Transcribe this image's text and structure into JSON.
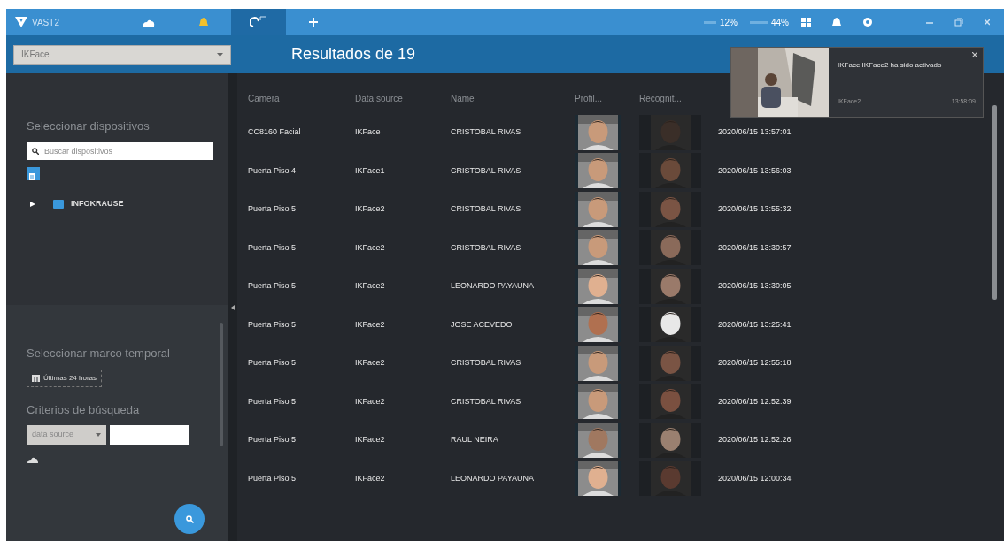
{
  "app": {
    "name": "VAST2"
  },
  "tabs": [
    {
      "kind": "cloud",
      "selected": false
    },
    {
      "kind": "alert",
      "selected": false
    },
    {
      "kind": "face",
      "selected": true
    },
    {
      "kind": "add",
      "selected": false
    }
  ],
  "stats": [
    {
      "kind": "cpu",
      "reading": "12%"
    },
    {
      "kind": "memory",
      "reading": "44%"
    }
  ],
  "toolbar": {
    "source_select": "IKFace",
    "results_title": "Resultados de 19"
  },
  "sidebar": {
    "devices_title": "Seleccionar dispositivos",
    "search": {
      "placeholder": "Buscar dispositivos"
    },
    "tree": [
      {
        "label": "INFOKRAUSE",
        "expanded": false
      }
    ],
    "time_title": "Seleccionar marco temporal",
    "time_button": "Últimas 24 horas",
    "criteria_title": "Criterios de búsqueda",
    "criteria_select": "data source"
  },
  "table": {
    "columns": [
      "Camera",
      "Data source",
      "Name",
      "Profil...",
      "Recognit..."
    ],
    "rows": [
      {
        "camera": "CC8160 Facial",
        "source": "IKFace",
        "name": "CRISTOBAL RIVAS",
        "time": "2020/06/15 13:57:01"
      },
      {
        "camera": "Puerta Piso 4",
        "source": "IKFace1",
        "name": "CRISTOBAL RIVAS",
        "time": "2020/06/15 13:56:03"
      },
      {
        "camera": "Puerta Piso 5",
        "source": "IKFace2",
        "name": "CRISTOBAL RIVAS",
        "time": "2020/06/15 13:55:32"
      },
      {
        "camera": "Puerta Piso 5",
        "source": "IKFace2",
        "name": "CRISTOBAL RIVAS",
        "time": "2020/06/15 13:30:57"
      },
      {
        "camera": "Puerta Piso 5",
        "source": "IKFace2",
        "name": "LEONARDO PAYAUNA",
        "time": "2020/06/15 13:30:05"
      },
      {
        "camera": "Puerta Piso 5",
        "source": "IKFace2",
        "name": "JOSE ACEVEDO",
        "time": "2020/06/15 13:25:41"
      },
      {
        "camera": "Puerta Piso 5",
        "source": "IKFace2",
        "name": "CRISTOBAL RIVAS",
        "time": "2020/06/15 12:55:18"
      },
      {
        "camera": "Puerta Piso 5",
        "source": "IKFace2",
        "name": "CRISTOBAL RIVAS",
        "time": "2020/06/15 12:52:39"
      },
      {
        "camera": "Puerta Piso 5",
        "source": "IKFace2",
        "name": "RAUL NEIRA",
        "time": "2020/06/15 12:52:26"
      },
      {
        "camera": "Puerta Piso 5",
        "source": "IKFace2",
        "name": "LEONARDO PAYAUNA",
        "time": "2020/06/15 12:00:34"
      }
    ]
  },
  "notification": {
    "message": "IKFace IKFace2 ha sido activado",
    "source": "IKFace2",
    "time": "13:58:09"
  }
}
